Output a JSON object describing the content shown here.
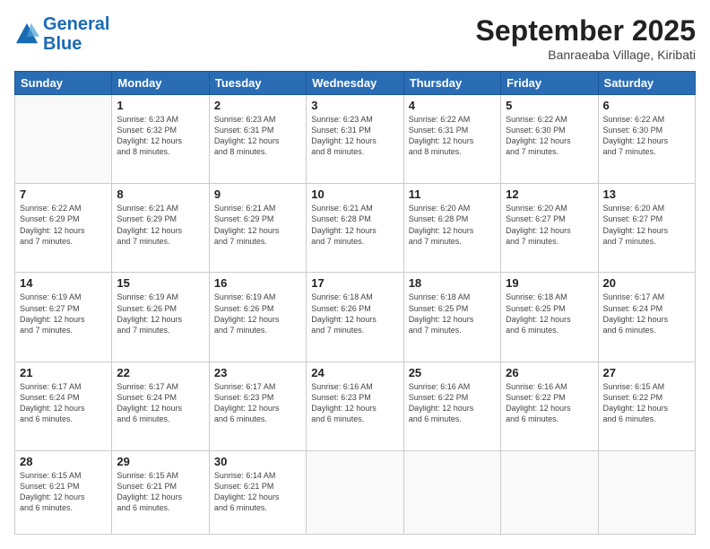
{
  "header": {
    "logo_line1": "General",
    "logo_line2": "Blue",
    "month": "September 2025",
    "location": "Banraeaba Village, Kiribati"
  },
  "days_of_week": [
    "Sunday",
    "Monday",
    "Tuesday",
    "Wednesday",
    "Thursday",
    "Friday",
    "Saturday"
  ],
  "weeks": [
    [
      {
        "day": "",
        "info": ""
      },
      {
        "day": "1",
        "info": "Sunrise: 6:23 AM\nSunset: 6:32 PM\nDaylight: 12 hours\nand 8 minutes."
      },
      {
        "day": "2",
        "info": "Sunrise: 6:23 AM\nSunset: 6:31 PM\nDaylight: 12 hours\nand 8 minutes."
      },
      {
        "day": "3",
        "info": "Sunrise: 6:23 AM\nSunset: 6:31 PM\nDaylight: 12 hours\nand 8 minutes."
      },
      {
        "day": "4",
        "info": "Sunrise: 6:22 AM\nSunset: 6:31 PM\nDaylight: 12 hours\nand 8 minutes."
      },
      {
        "day": "5",
        "info": "Sunrise: 6:22 AM\nSunset: 6:30 PM\nDaylight: 12 hours\nand 7 minutes."
      },
      {
        "day": "6",
        "info": "Sunrise: 6:22 AM\nSunset: 6:30 PM\nDaylight: 12 hours\nand 7 minutes."
      }
    ],
    [
      {
        "day": "7",
        "info": "Sunrise: 6:22 AM\nSunset: 6:29 PM\nDaylight: 12 hours\nand 7 minutes."
      },
      {
        "day": "8",
        "info": "Sunrise: 6:21 AM\nSunset: 6:29 PM\nDaylight: 12 hours\nand 7 minutes."
      },
      {
        "day": "9",
        "info": "Sunrise: 6:21 AM\nSunset: 6:29 PM\nDaylight: 12 hours\nand 7 minutes."
      },
      {
        "day": "10",
        "info": "Sunrise: 6:21 AM\nSunset: 6:28 PM\nDaylight: 12 hours\nand 7 minutes."
      },
      {
        "day": "11",
        "info": "Sunrise: 6:20 AM\nSunset: 6:28 PM\nDaylight: 12 hours\nand 7 minutes."
      },
      {
        "day": "12",
        "info": "Sunrise: 6:20 AM\nSunset: 6:27 PM\nDaylight: 12 hours\nand 7 minutes."
      },
      {
        "day": "13",
        "info": "Sunrise: 6:20 AM\nSunset: 6:27 PM\nDaylight: 12 hours\nand 7 minutes."
      }
    ],
    [
      {
        "day": "14",
        "info": "Sunrise: 6:19 AM\nSunset: 6:27 PM\nDaylight: 12 hours\nand 7 minutes."
      },
      {
        "day": "15",
        "info": "Sunrise: 6:19 AM\nSunset: 6:26 PM\nDaylight: 12 hours\nand 7 minutes."
      },
      {
        "day": "16",
        "info": "Sunrise: 6:19 AM\nSunset: 6:26 PM\nDaylight: 12 hours\nand 7 minutes."
      },
      {
        "day": "17",
        "info": "Sunrise: 6:18 AM\nSunset: 6:26 PM\nDaylight: 12 hours\nand 7 minutes."
      },
      {
        "day": "18",
        "info": "Sunrise: 6:18 AM\nSunset: 6:25 PM\nDaylight: 12 hours\nand 7 minutes."
      },
      {
        "day": "19",
        "info": "Sunrise: 6:18 AM\nSunset: 6:25 PM\nDaylight: 12 hours\nand 6 minutes."
      },
      {
        "day": "20",
        "info": "Sunrise: 6:17 AM\nSunset: 6:24 PM\nDaylight: 12 hours\nand 6 minutes."
      }
    ],
    [
      {
        "day": "21",
        "info": "Sunrise: 6:17 AM\nSunset: 6:24 PM\nDaylight: 12 hours\nand 6 minutes."
      },
      {
        "day": "22",
        "info": "Sunrise: 6:17 AM\nSunset: 6:24 PM\nDaylight: 12 hours\nand 6 minutes."
      },
      {
        "day": "23",
        "info": "Sunrise: 6:17 AM\nSunset: 6:23 PM\nDaylight: 12 hours\nand 6 minutes."
      },
      {
        "day": "24",
        "info": "Sunrise: 6:16 AM\nSunset: 6:23 PM\nDaylight: 12 hours\nand 6 minutes."
      },
      {
        "day": "25",
        "info": "Sunrise: 6:16 AM\nSunset: 6:22 PM\nDaylight: 12 hours\nand 6 minutes."
      },
      {
        "day": "26",
        "info": "Sunrise: 6:16 AM\nSunset: 6:22 PM\nDaylight: 12 hours\nand 6 minutes."
      },
      {
        "day": "27",
        "info": "Sunrise: 6:15 AM\nSunset: 6:22 PM\nDaylight: 12 hours\nand 6 minutes."
      }
    ],
    [
      {
        "day": "28",
        "info": "Sunrise: 6:15 AM\nSunset: 6:21 PM\nDaylight: 12 hours\nand 6 minutes."
      },
      {
        "day": "29",
        "info": "Sunrise: 6:15 AM\nSunset: 6:21 PM\nDaylight: 12 hours\nand 6 minutes."
      },
      {
        "day": "30",
        "info": "Sunrise: 6:14 AM\nSunset: 6:21 PM\nDaylight: 12 hours\nand 6 minutes."
      },
      {
        "day": "",
        "info": ""
      },
      {
        "day": "",
        "info": ""
      },
      {
        "day": "",
        "info": ""
      },
      {
        "day": "",
        "info": ""
      }
    ]
  ]
}
